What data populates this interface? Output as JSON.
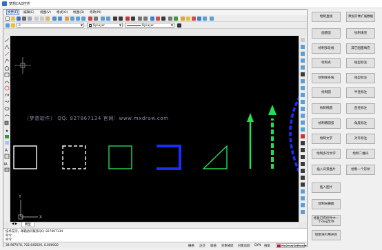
{
  "window": {
    "title": "梦想CAD控件"
  },
  "menu": [
    "文件(F)",
    "编辑(E)",
    "视图(V)",
    "格式(O)",
    "绘图(D)",
    "修改(M)"
  ],
  "properties": {
    "layer": "0",
    "color": "ByLayer",
    "linetype": "ByLayer"
  },
  "canvas": {
    "watermark": "（梦想软件）   QQ: 827867134   官网：www.mxdraw.com",
    "ucs_y": "Y",
    "ucs_x": "X"
  },
  "tabs": {
    "model": "模型"
  },
  "command": {
    "history": "技术支持，邮箱访问联系QQ: 827867134",
    "prompt1": "命令:",
    "prompt2": "命令:"
  },
  "status": {
    "coords": "38.987078,  702.645626,  0.000000",
    "buttons": [
      "栅格",
      "正交",
      "极轴",
      "对象捕捉",
      "对象追踪",
      "DYN",
      "线宽"
    ],
    "brand": "MxDrawSoftware"
  },
  "side_buttons": {
    "col1": [
      "绘制直线",
      "画圆弧",
      "绘制多段线",
      "绘制点",
      "绘制样条线",
      "绘制圆",
      "绘制椭圆",
      "绘制椭圆弧",
      "绘制文字",
      "绘制多行文字",
      "插入背景图片",
      "插入图片",
      "绘制光栅图",
      "修复已有控件中一个dwg文件",
      "绘制块引用并且"
    ],
    "col2": [
      "添加实体扩展数据",
      "绘制填充",
      "其它图面填充",
      "线型标注",
      "线型标注",
      "半径标注",
      "直径标注",
      "角度标注",
      "对齐标注",
      "绘制二维码",
      "绘制一个形状"
    ]
  },
  "colors": {
    "canvas_bg": "#000000",
    "shape_white": "#ffffff",
    "shape_green": "#22dd55",
    "shape_blue": "#1a2cff",
    "accent_blue": "#2a6fd6"
  }
}
